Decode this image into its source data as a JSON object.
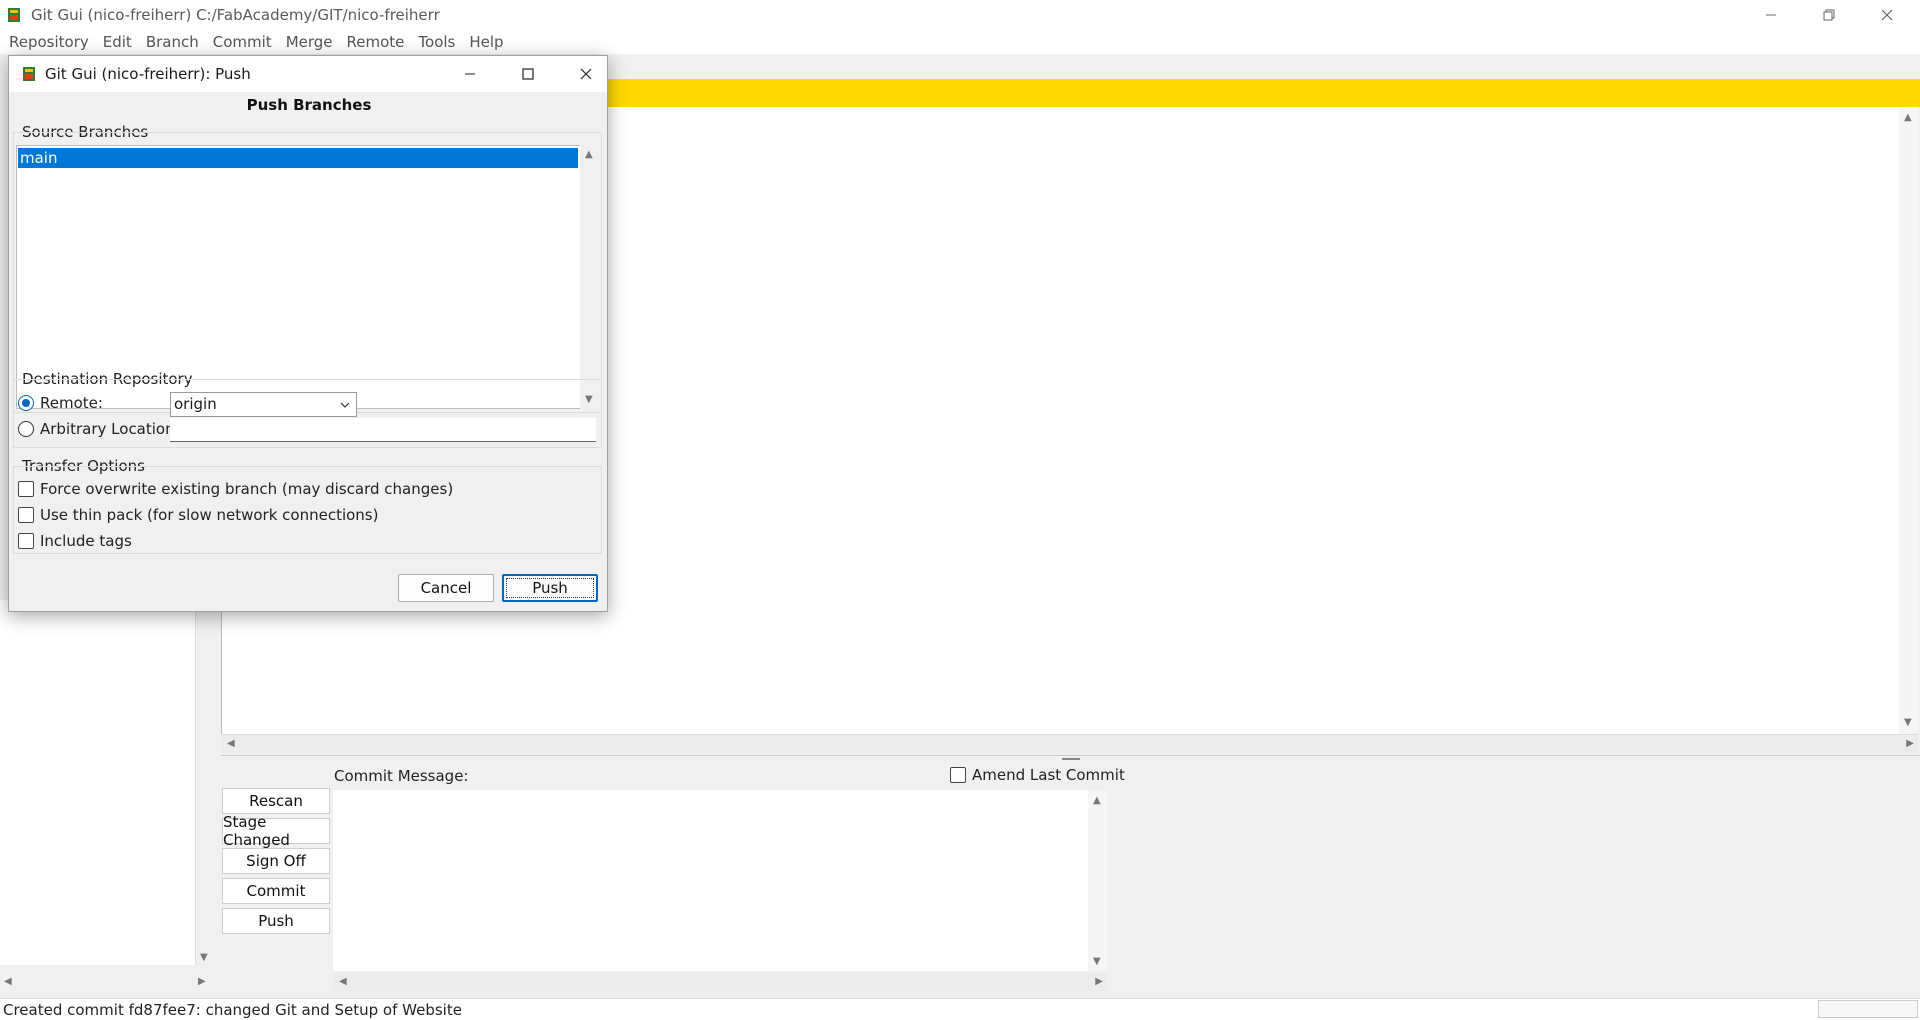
{
  "window": {
    "title": "Git Gui (nico-freiherr) C:/FabAcademy/GIT/nico-freiherr",
    "controls": [
      "minimize",
      "restore",
      "close"
    ]
  },
  "menubar": {
    "items": [
      "Repository",
      "Edit",
      "Branch",
      "Commit",
      "Merge",
      "Remote",
      "Tools",
      "Help"
    ]
  },
  "commit_panel": {
    "label": "Commit Message:",
    "amend_label": "Amend Last Commit",
    "amend_checked": false,
    "buttons": {
      "rescan": "Rescan",
      "stage_changed": "Stage Changed",
      "sign_off": "Sign Off",
      "commit": "Commit",
      "push": "Push"
    },
    "message": ""
  },
  "statusbar": {
    "text": "Created commit fd87fee7: changed Git and Setup of Website"
  },
  "dialog": {
    "title": "Git Gui (nico-freiherr): Push",
    "heading": "Push Branches",
    "source_branches": {
      "label": "Source Branches",
      "items": [
        "main"
      ],
      "selected": "main"
    },
    "destination": {
      "label": "Destination Repository",
      "remote_label": "Remote:",
      "remote_selected": true,
      "remote_value": "origin",
      "arbitrary_label": "Arbitrary Location:",
      "arbitrary_value": ""
    },
    "transfer_options": {
      "label": "Transfer Options",
      "force_label": "Force overwrite existing branch (may discard changes)",
      "thin_pack_label": "Use thin pack (for slow network connections)",
      "tags_label": "Include tags",
      "force_checked": false,
      "thin_pack_checked": false,
      "tags_checked": false
    },
    "buttons": {
      "cancel": "Cancel",
      "push": "Push"
    }
  },
  "colors": {
    "diff_header": "#ffd800",
    "selection": "#0078d7",
    "accent": "#0067c0"
  },
  "icons": [
    "git-gui-app-icon",
    "minimize-icon",
    "restore-icon",
    "maximize-icon",
    "close-icon",
    "chevron-down-icon"
  ]
}
